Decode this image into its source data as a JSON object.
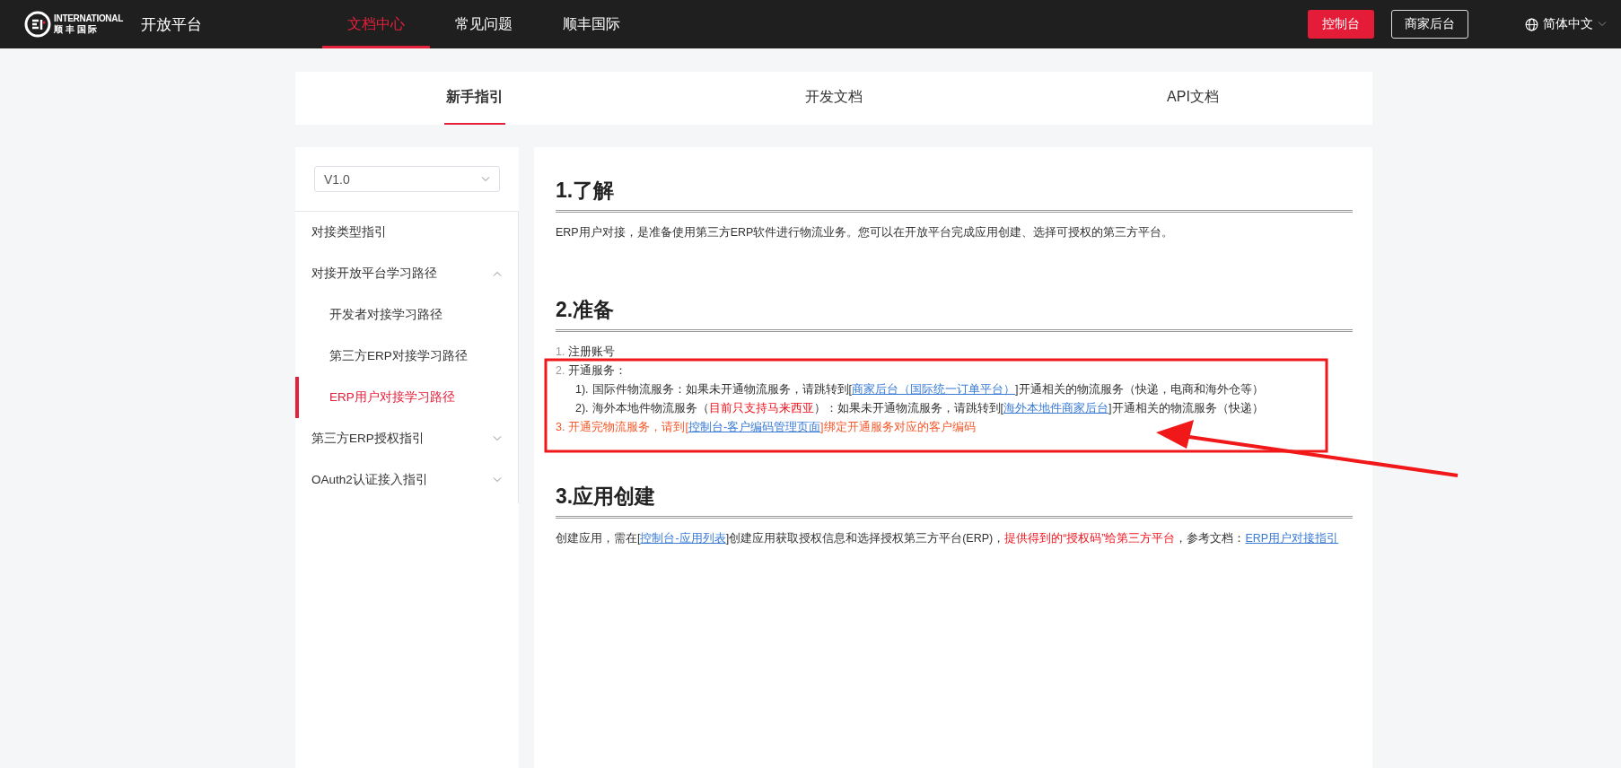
{
  "header": {
    "logo_text": "INTERNATIONAL",
    "logo_subtext": "顺 丰 国 际",
    "site_title": "开放平台",
    "nav": [
      {
        "label": "文档中心",
        "selected": true
      },
      {
        "label": "常见问题",
        "selected": false
      },
      {
        "label": "顺丰国际",
        "selected": false
      }
    ],
    "buttons": [
      {
        "label": "控制台",
        "kind": "primary"
      },
      {
        "label": "商家后台",
        "kind": "outline"
      }
    ],
    "language": "简体中文"
  },
  "tabs": [
    {
      "label": "新手指引",
      "selected": true
    },
    {
      "label": "开发文档",
      "selected": false
    },
    {
      "label": "API文档",
      "selected": false
    }
  ],
  "sidebar": {
    "version": "V1.0",
    "items": [
      {
        "label": "对接类型指引",
        "selected": false
      },
      {
        "label": "对接开放平台学习路径",
        "selected": false,
        "expanded": true,
        "children": [
          {
            "label": "开发者对接学习路径",
            "selected": false
          },
          {
            "label": "第三方ERP对接学习路径",
            "selected": false
          },
          {
            "label": "ERP用户对接学习路径",
            "selected": true
          }
        ]
      },
      {
        "label": "第三方ERP授权指引",
        "selected": false,
        "expanded": false
      },
      {
        "label": "OAuth2认证接入指引",
        "selected": false,
        "expanded": false
      }
    ]
  },
  "sections": [
    {
      "heading": "1.了解",
      "paragraph": [
        {
          "kind": "plain",
          "text": "ERP用户对接，是准备使用第三方ERP软件进行物流业务。您可以在开放平台完成应用创建、选择可授权的第三方平台。"
        }
      ]
    },
    {
      "heading": "2.准备",
      "list": [
        {
          "marker": "1.",
          "highlighted": false,
          "segments": [
            {
              "kind": "plain",
              "text": "注册账号"
            }
          ]
        },
        {
          "marker": "2.",
          "highlighted": false,
          "segments": [
            {
              "kind": "plain",
              "text": "开通服务："
            }
          ],
          "children": [
            {
              "marker": "1).",
              "segments": [
                {
                  "kind": "plain",
                  "text": "国际件物流服务：如果未开通物流服务，请跳转到["
                },
                {
                  "kind": "link",
                  "text": "商家后台（国际统一订单平台）"
                },
                {
                  "kind": "plain",
                  "text": "]开通相关的物流服务（快递，电商和海外仓等）"
                }
              ]
            },
            {
              "marker": "2).",
              "segments": [
                {
                  "kind": "plain",
                  "text": "海外本地件物流服务（"
                },
                {
                  "kind": "red",
                  "text": "目前只支持马来西亚"
                },
                {
                  "kind": "plain",
                  "text": "）：如果未开通物流服务，请跳转到["
                },
                {
                  "kind": "link",
                  "text": "海外本地件商家后台"
                },
                {
                  "kind": "plain",
                  "text": "]开通相关的物流服务（快递）"
                }
              ]
            }
          ]
        },
        {
          "marker": "3.",
          "highlighted": true,
          "segments": [
            {
              "kind": "plain",
              "text": "开通完物流服务，请到["
            },
            {
              "kind": "link",
              "text": "控制台-客户编码管理页面"
            },
            {
              "kind": "plain",
              "text": "]绑定开通服务对应的客户编码"
            }
          ]
        }
      ]
    },
    {
      "heading": "3.应用创建",
      "paragraph": [
        {
          "kind": "plain",
          "text": "创建应用，需在["
        },
        {
          "kind": "link",
          "text": "控制台-应用列表"
        },
        {
          "kind": "plain",
          "text": "]创建应用获取授权信息和选择授权第三方平台(ERP)，"
        },
        {
          "kind": "red",
          "text": "提供得到的“授权码”给第三方平台"
        },
        {
          "kind": "plain",
          "text": "，参考文档："
        },
        {
          "kind": "link",
          "text": "ERP用户对接指引"
        }
      ]
    }
  ]
}
